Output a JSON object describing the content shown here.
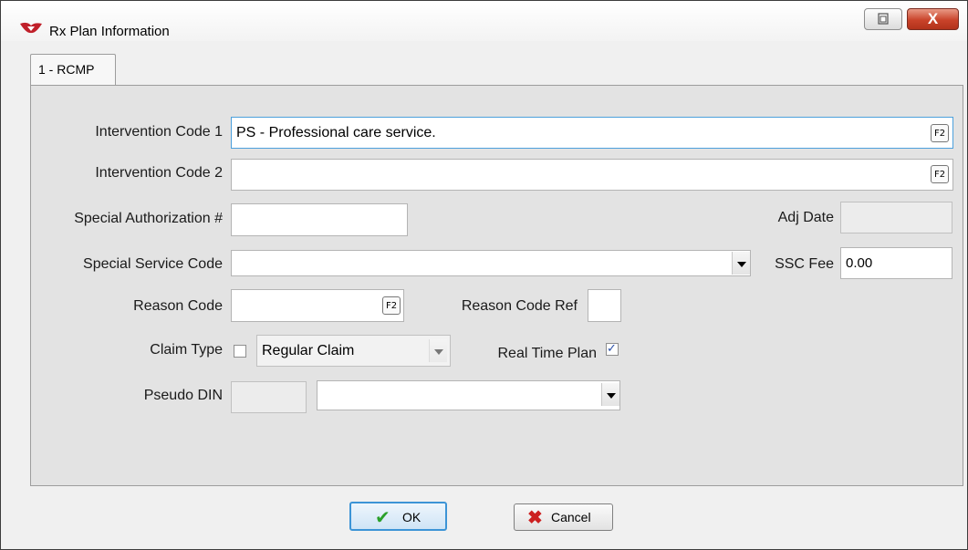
{
  "window": {
    "title": "Rx Plan Information",
    "close_label": "X"
  },
  "tabs": [
    {
      "label": "1 - RCMP"
    }
  ],
  "form": {
    "intervention_code_1": {
      "label": "Intervention Code 1",
      "value": "PS - Professional care service.",
      "lookup_key": "F2"
    },
    "intervention_code_2": {
      "label": "Intervention Code 2",
      "value": "",
      "lookup_key": "F2"
    },
    "special_authorization": {
      "label": "Special Authorization #",
      "value": ""
    },
    "adj_date": {
      "label": "Adj Date",
      "value": ""
    },
    "special_service_code": {
      "label": "Special Service Code",
      "value": ""
    },
    "ssc_fee": {
      "label": "SSC Fee",
      "value": "0.00"
    },
    "reason_code": {
      "label": "Reason Code",
      "value": "",
      "lookup_key": "F2"
    },
    "reason_code_ref": {
      "label": "Reason Code Ref",
      "value": ""
    },
    "claim_type": {
      "label": "Claim Type",
      "checked": false,
      "selected": "Regular Claim"
    },
    "real_time_plan": {
      "label": "Real Time Plan",
      "checked": true
    },
    "pseudo_din": {
      "label": "Pseudo DIN",
      "value": "",
      "selected": ""
    }
  },
  "buttons": {
    "ok": "OK",
    "cancel": "Cancel"
  },
  "colors": {
    "accent": "#3c94d6",
    "close_red": "#c9432a",
    "panel": "#e3e3e3",
    "ok_check": "#2aa02a",
    "cancel_x": "#cc2020"
  }
}
